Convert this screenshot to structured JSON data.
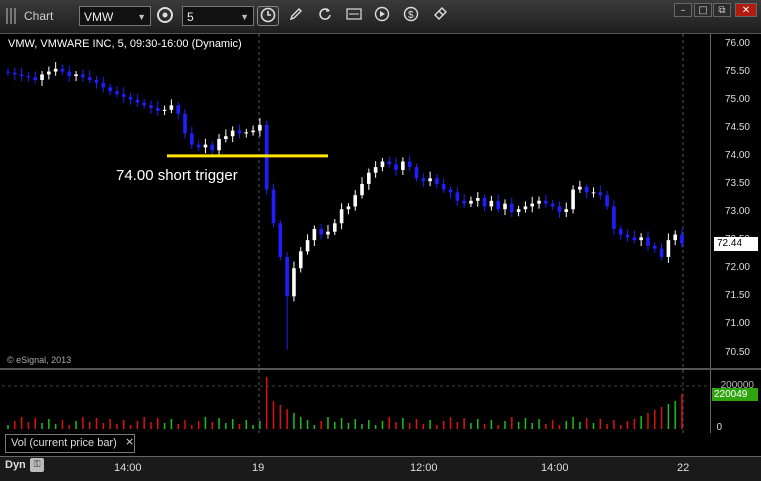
{
  "window": {
    "title": "Chart",
    "symbol_value": "VMW",
    "interval_value": "5",
    "buttons": [
      "refresh-cycle-icon",
      "clock-icon",
      "pencil-icon",
      "redo-icon",
      "quote-icon",
      "play-icon",
      "dollar-icon",
      "link-icon"
    ]
  },
  "chart": {
    "title": "VMW, VMWARE INC, 5, 09:30-16:00 (Dynamic)",
    "copyright": "© eSignal, 2013",
    "annotation": "74.00 short trigger",
    "last_price_label": "72.44",
    "volume_label": "220049",
    "volume_top_tick": "200000",
    "volume_zero_tick": "0"
  },
  "y_ticks": [
    "76.00",
    "75.50",
    "75.00",
    "74.50",
    "74.00",
    "73.50",
    "73.00",
    "72.50",
    "72.00",
    "71.50",
    "71.00",
    "70.50"
  ],
  "x_ticks": [
    "14:00",
    "19",
    "12:00",
    "14:00",
    "22"
  ],
  "study": {
    "label": "Vol (current price bar)",
    "close": "×"
  },
  "bottom": {
    "mode_label": "Dyn"
  },
  "colors": {
    "up": "#ffffff",
    "down": "#1e1eff",
    "trigger_line": "#ffe600",
    "vol_up": "#19c019",
    "vol_down": "#e01010",
    "badge_vol": "#2ea50e"
  },
  "chart_data": {
    "type": "candlestick",
    "title": "VMW, VMWARE INC, 5, 09:30-16:00 (Dynamic)",
    "ylim": [
      70.3,
      76.2
    ],
    "reference_line": {
      "value": 74.0,
      "label": "74.00 short trigger"
    },
    "last_price": 72.44,
    "last_volume": 220049,
    "series": [
      {
        "name": "close",
        "values": [
          75.48,
          75.45,
          75.42,
          75.4,
          75.35,
          75.45,
          75.5,
          75.55,
          75.5,
          75.42,
          75.45,
          75.4,
          75.35,
          75.3,
          75.22,
          75.15,
          75.1,
          75.05,
          75.0,
          74.95,
          74.9,
          74.85,
          74.8,
          74.82,
          74.9,
          74.75,
          74.4,
          74.2,
          74.15,
          74.2,
          74.1,
          74.3,
          74.35,
          74.45,
          74.4,
          74.42,
          74.45,
          74.55,
          73.4,
          72.8,
          72.2,
          71.5,
          72.0,
          72.3,
          72.5,
          72.7,
          72.6,
          72.65,
          72.8,
          73.05,
          73.1,
          73.3,
          73.5,
          73.7,
          73.8,
          73.9,
          73.85,
          73.75,
          73.9,
          73.8,
          73.6,
          73.55,
          73.6,
          73.5,
          73.4,
          73.35,
          73.2,
          73.15,
          73.2,
          73.25,
          73.1,
          73.2,
          73.05,
          73.15,
          73.0,
          73.05,
          73.1,
          73.15,
          73.2,
          73.15,
          73.1,
          73.0,
          73.05,
          73.4,
          73.45,
          73.35,
          73.35,
          73.3,
          73.1,
          72.7,
          72.6,
          72.55,
          72.5,
          72.55,
          72.4,
          72.35,
          72.2,
          72.5,
          72.6,
          72.44
        ]
      }
    ]
  }
}
